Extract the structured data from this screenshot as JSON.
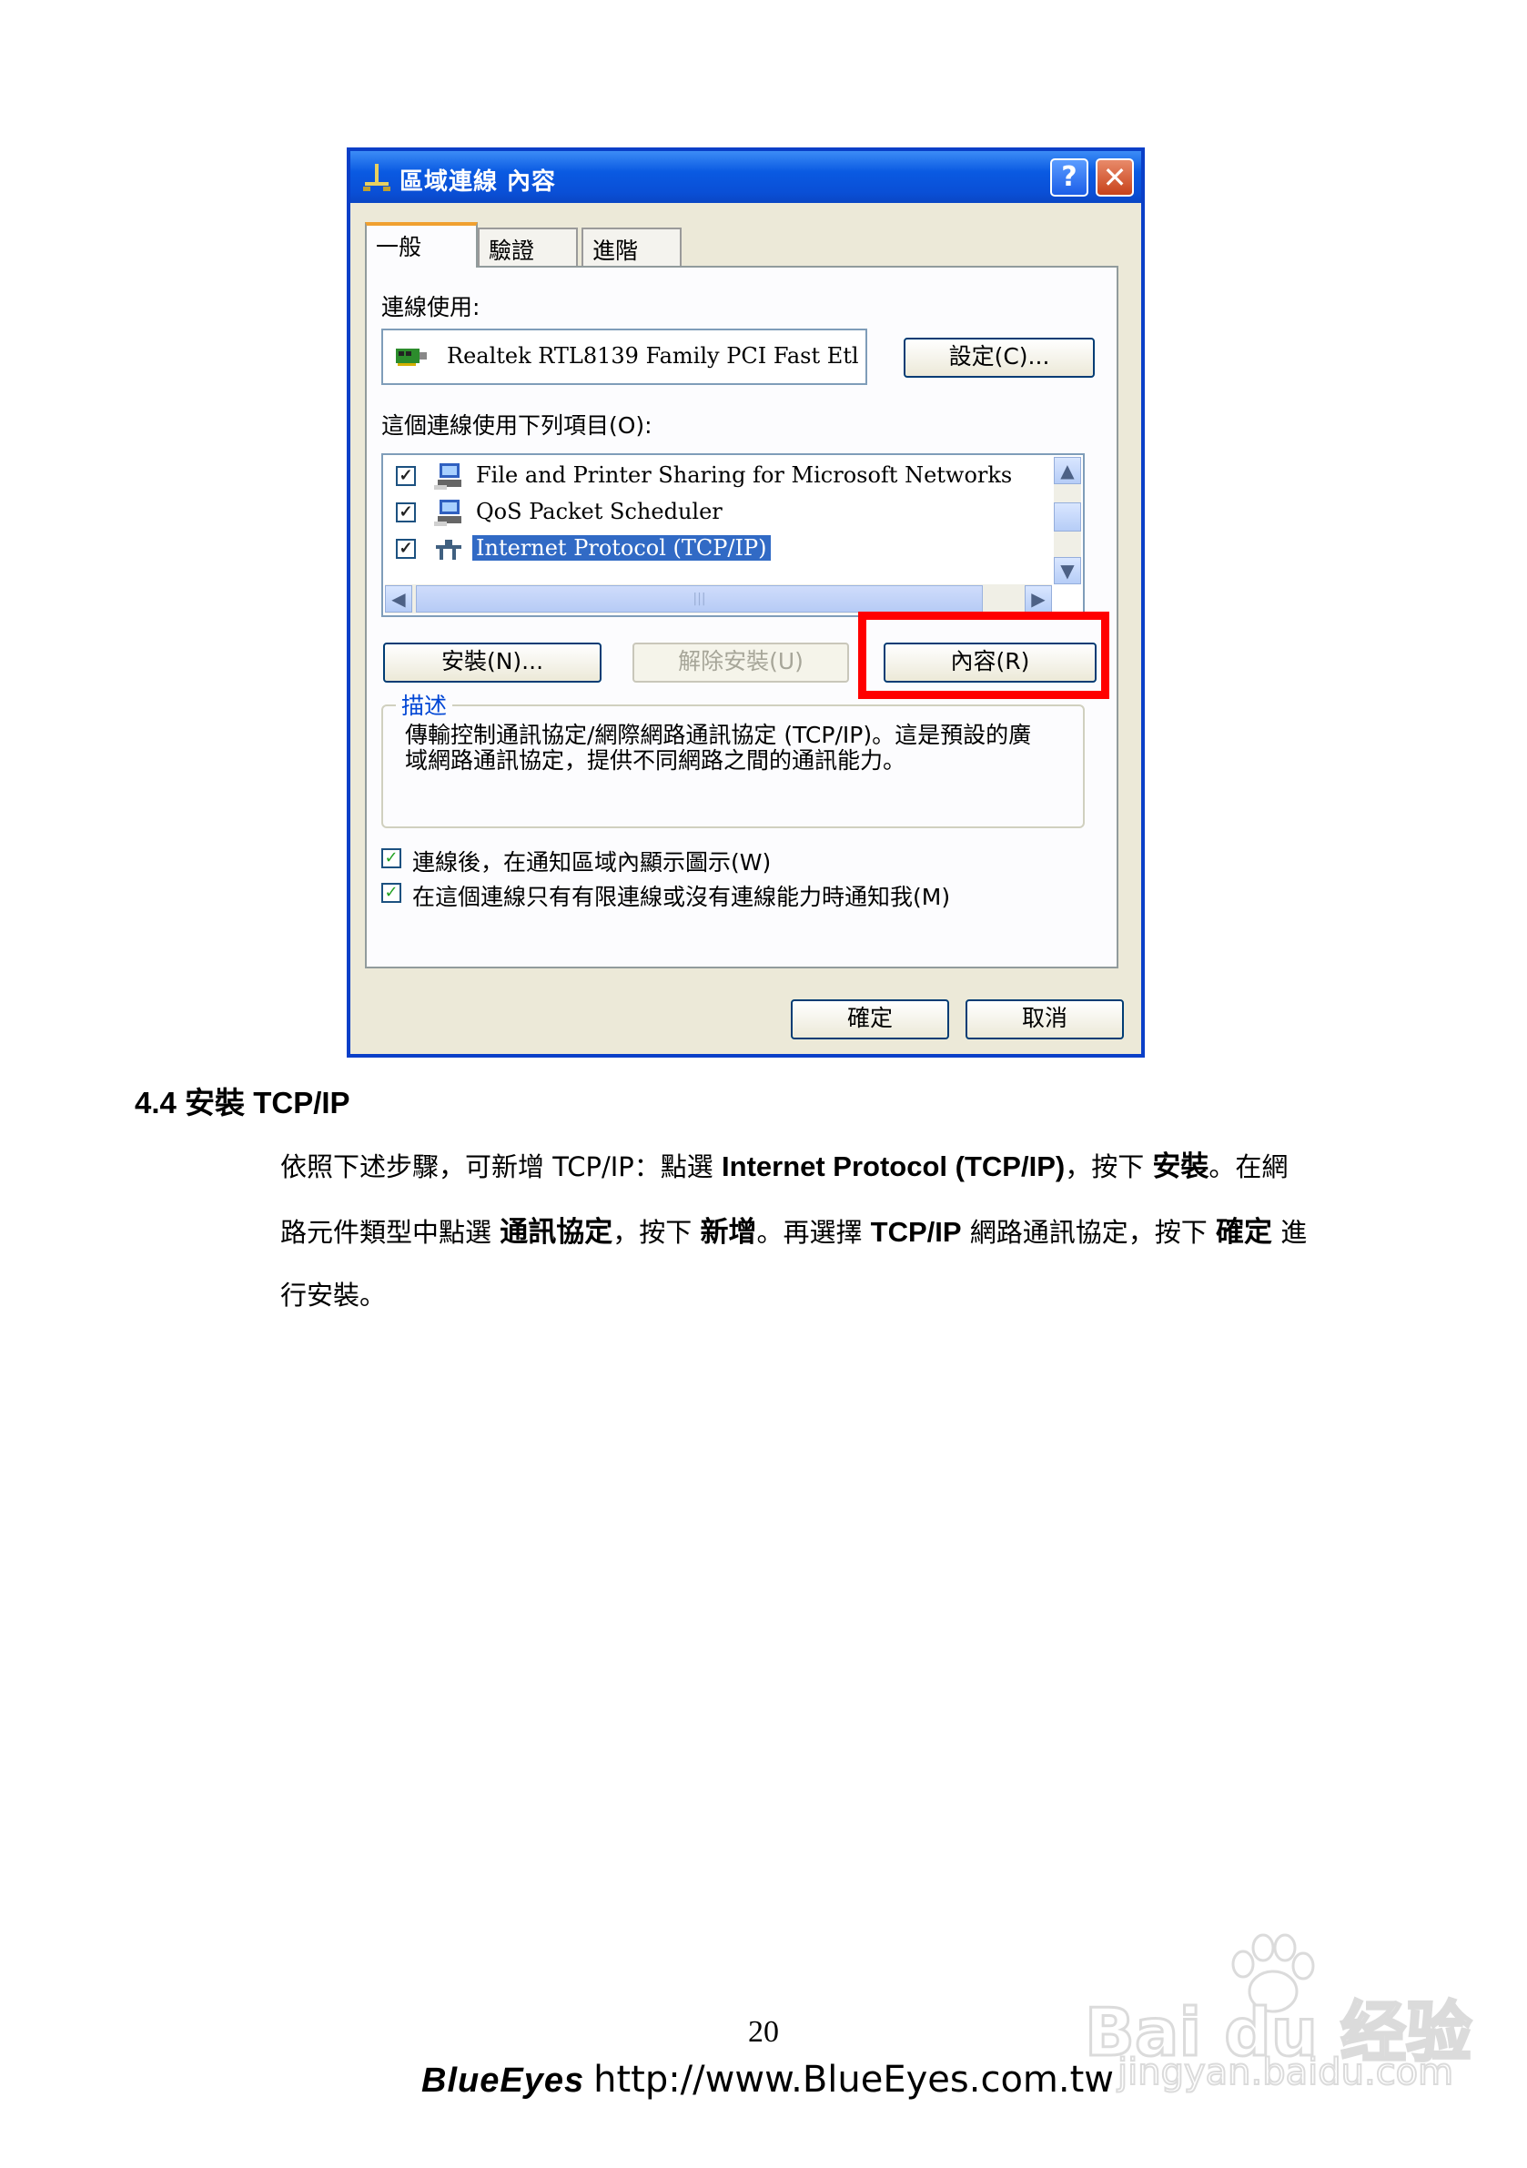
{
  "dialog": {
    "title": "區域連線 內容",
    "help_glyph": "?",
    "close_glyph": "✕",
    "tabs": [
      "一般",
      "驗證",
      "進階"
    ],
    "connect_using_label": "連線使用:",
    "adapter_name": "Realtek RTL8139 Family PCI Fast Etl",
    "configure_button": "設定(C)...",
    "components_label": "這個連線使用下列項目(O):",
    "components": [
      {
        "label": "File and Printer Sharing for Microsoft Networks",
        "checked": true,
        "icon": "network-computer-icon"
      },
      {
        "label": "QoS Packet Scheduler",
        "checked": true,
        "icon": "network-computer-icon"
      },
      {
        "label": "Internet Protocol (TCP/IP)",
        "checked": true,
        "selected": true,
        "icon": "protocol-icon"
      }
    ],
    "scroll_thumb_glyph": "|||",
    "install_button": "安裝(N)...",
    "uninstall_button": "解除安裝(U)",
    "properties_button": "內容(R)",
    "description_title": "描述",
    "description_text": "傳輸控制通訊協定/網際網路通訊協定 (TCP/IP)。這是預設的廣域網路通訊協定，提供不同網路之間的通訊能力。",
    "show_icon_checkbox": "連線後，在通知區域內顯示圖示(W)",
    "notify_checkbox": "在這個連線只有有限連線或沒有連線能力時通知我(M)",
    "ok_button": "確定",
    "cancel_button": "取消",
    "highlight_color": "#ff0000"
  },
  "section": {
    "title": "4.4 安裝 TCP/IP",
    "line1": {
      "t1": "依照下述步驟，可新增 TCP/IP：點選 ",
      "b1": "Internet Protocol (TCP/IP)",
      "t2": "，按下 ",
      "b2": "安裝",
      "t3": "。在網"
    },
    "line2": {
      "t1": "路元件類型中點選 ",
      "b1": "通訊協定",
      "t2": "，按下 ",
      "b2": "新增",
      "t3": "。再選擇 ",
      "b3": "TCP/IP",
      "t4": " 網路通訊協定，按下 ",
      "b4": "確定",
      "t5": " 進"
    },
    "line3": "行安裝。"
  },
  "page_number": "20",
  "footer": {
    "brand": "BlueEyes",
    "url": "http://www.BlueEyes.com.tw"
  },
  "watermark": {
    "main": "Bai du 经验",
    "sub": "jingyan.baidu.com"
  }
}
